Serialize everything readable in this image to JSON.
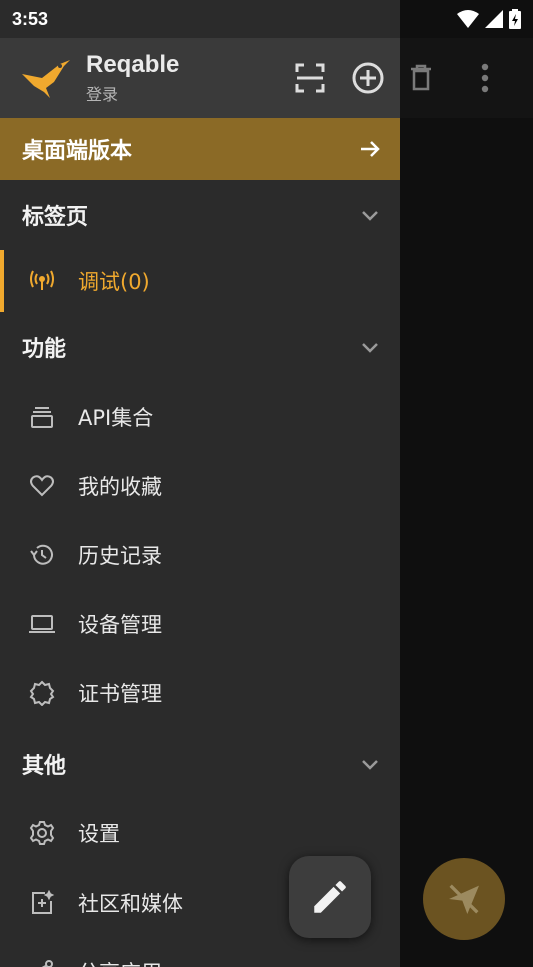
{
  "status_bar": {
    "time": "3:53"
  },
  "header": {
    "app_name": "Reqable",
    "login_label": "登录"
  },
  "desktop_banner": {
    "label": "桌面端版本"
  },
  "sections": {
    "tabs": {
      "title": "标签页"
    },
    "features": {
      "title": "功能"
    },
    "others": {
      "title": "其他"
    }
  },
  "tabs_items": [
    {
      "label": "调试(0)",
      "icon": "antenna-icon"
    }
  ],
  "feature_items": [
    {
      "label": "API集合",
      "icon": "collection-icon"
    },
    {
      "label": "我的收藏",
      "icon": "heart-icon"
    },
    {
      "label": "历史记录",
      "icon": "history-icon"
    },
    {
      "label": "设备管理",
      "icon": "laptop-icon"
    },
    {
      "label": "证书管理",
      "icon": "certificate-icon"
    }
  ],
  "other_items": [
    {
      "label": "设置",
      "icon": "gear-icon"
    },
    {
      "label": "社区和媒体",
      "icon": "community-icon"
    },
    {
      "label": "分享应用",
      "icon": "share-icon"
    }
  ],
  "colors": {
    "accent": "#f0a92e",
    "banner": "#8b6a26",
    "drawer": "#2b2b2b"
  }
}
